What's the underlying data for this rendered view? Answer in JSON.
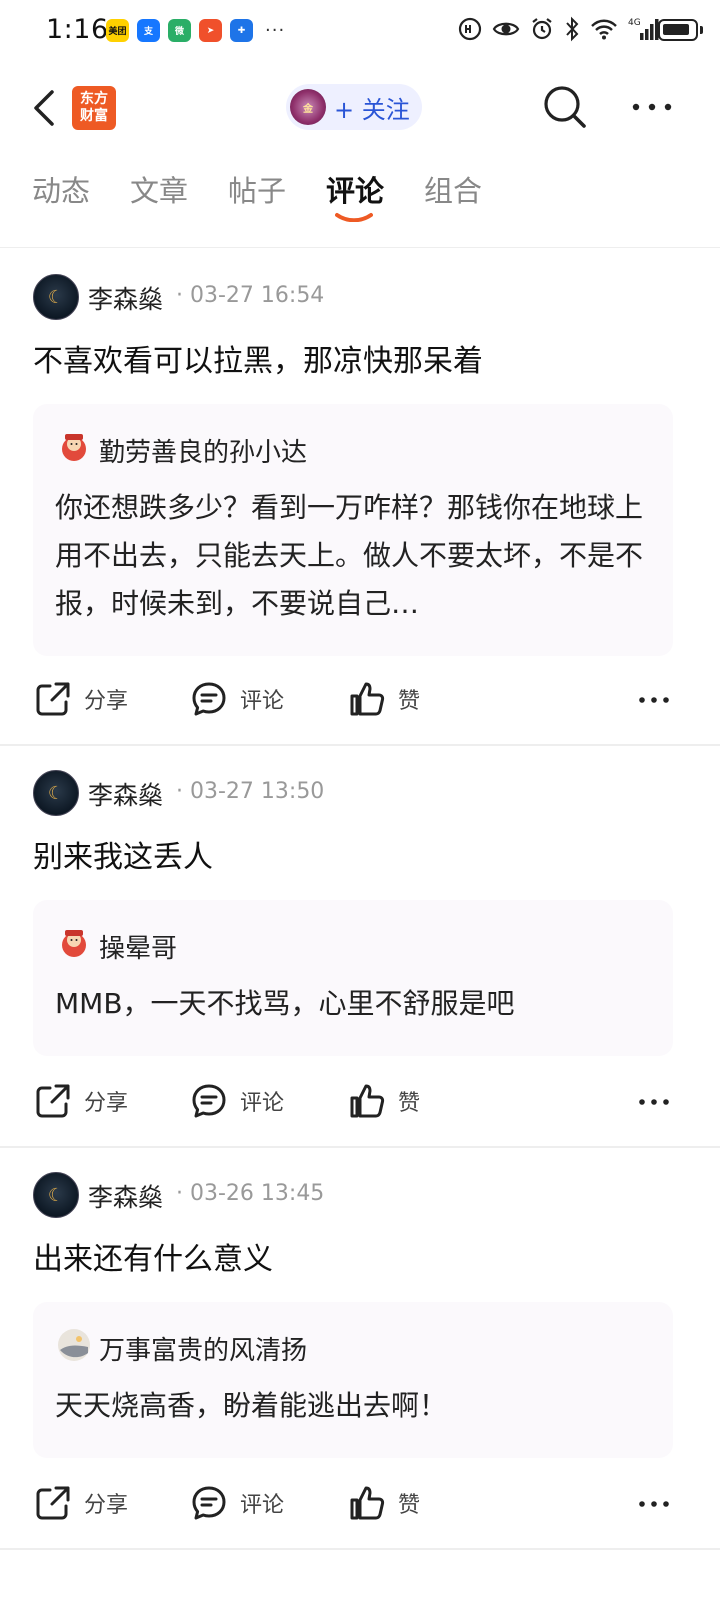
{
  "status_bar": {
    "time": "1:16",
    "apps": [
      {
        "name": "meituan-icon",
        "label": "美团",
        "color": "#ffd100",
        "text_color": "#111"
      },
      {
        "name": "alipay-icon",
        "label": "支",
        "color": "#1677ff",
        "text_color": "#fff"
      },
      {
        "name": "wechat-icon",
        "label": "微",
        "color": "#2aae67",
        "text_color": "#fff"
      },
      {
        "name": "send-app-icon",
        "label": "➤",
        "color": "#f0502b",
        "text_color": "#fff"
      },
      {
        "name": "puzzle-app-icon",
        "label": "✚",
        "color": "#1e74e8",
        "text_color": "#fff"
      }
    ],
    "more": "···",
    "network": "4G"
  },
  "header": {
    "logo_line1": "东方",
    "logo_line2": "财富",
    "follow_label": "+ 关注",
    "follow_avatar_text": "金"
  },
  "tabs": [
    {
      "label": "动态",
      "active": false
    },
    {
      "label": "文章",
      "active": false
    },
    {
      "label": "帖子",
      "active": false
    },
    {
      "label": "评论",
      "active": true
    },
    {
      "label": "组合",
      "active": false
    }
  ],
  "colors": {
    "accent": "#ee5a24",
    "follow_text": "#2a55d6",
    "quote_bg": "#fbf9fc",
    "divider": "#eeeeee"
  },
  "posts": [
    {
      "author": "李森燊",
      "date": "· 03-27 16:54",
      "text": "不喜欢看可以拉黑，那凉快那呆着",
      "quote": {
        "author": "勤劳善良的孙小达",
        "text": "你还想跌多少？看到一万咋样？那钱你在地球上用不出去，只能去天上。做人不要太坏，不是不报，时候未到，不要说自己…"
      }
    },
    {
      "author": "李森燊",
      "date": "· 03-27 13:50",
      "text": "别来我这丢人",
      "quote": {
        "author": "操晕哥",
        "text": "MMB，一天不找骂，心里不舒服是吧"
      }
    },
    {
      "author": "李森燊",
      "date": "· 03-26 13:45",
      "text": "出来还有什么意义",
      "quote": {
        "author": "万事富贵的风清扬",
        "text": "天天烧高香，盼着能逃出去啊！"
      }
    }
  ],
  "actions": {
    "share": "分享",
    "comment": "评论",
    "like": "赞"
  }
}
